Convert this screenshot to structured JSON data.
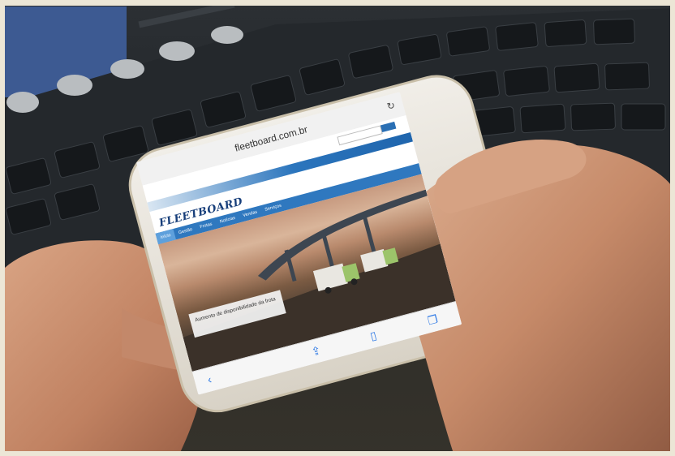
{
  "photo": {
    "subject": "hands-holding-smartphone-over-keyboard",
    "colors": {
      "frame": "#ece6d6",
      "phone_body": "#e9e5dc",
      "keyboard": "#24282c",
      "skin": "#c9926f",
      "site_blue": "#2f78bf"
    }
  },
  "browser": {
    "url": "fleetboard.com.br",
    "reload_icon": "reload-icon"
  },
  "website": {
    "logo": "FLEETBOARD",
    "nav": [
      "Início",
      "Gestão",
      "Frotas",
      "Notícias",
      "Vendas",
      "Serviços"
    ],
    "caption": "Aumento de disponibilidade da frota"
  },
  "toolbar": {
    "icons": [
      "back-icon",
      "share-icon",
      "bookmarks-icon",
      "tabs-icon"
    ]
  }
}
